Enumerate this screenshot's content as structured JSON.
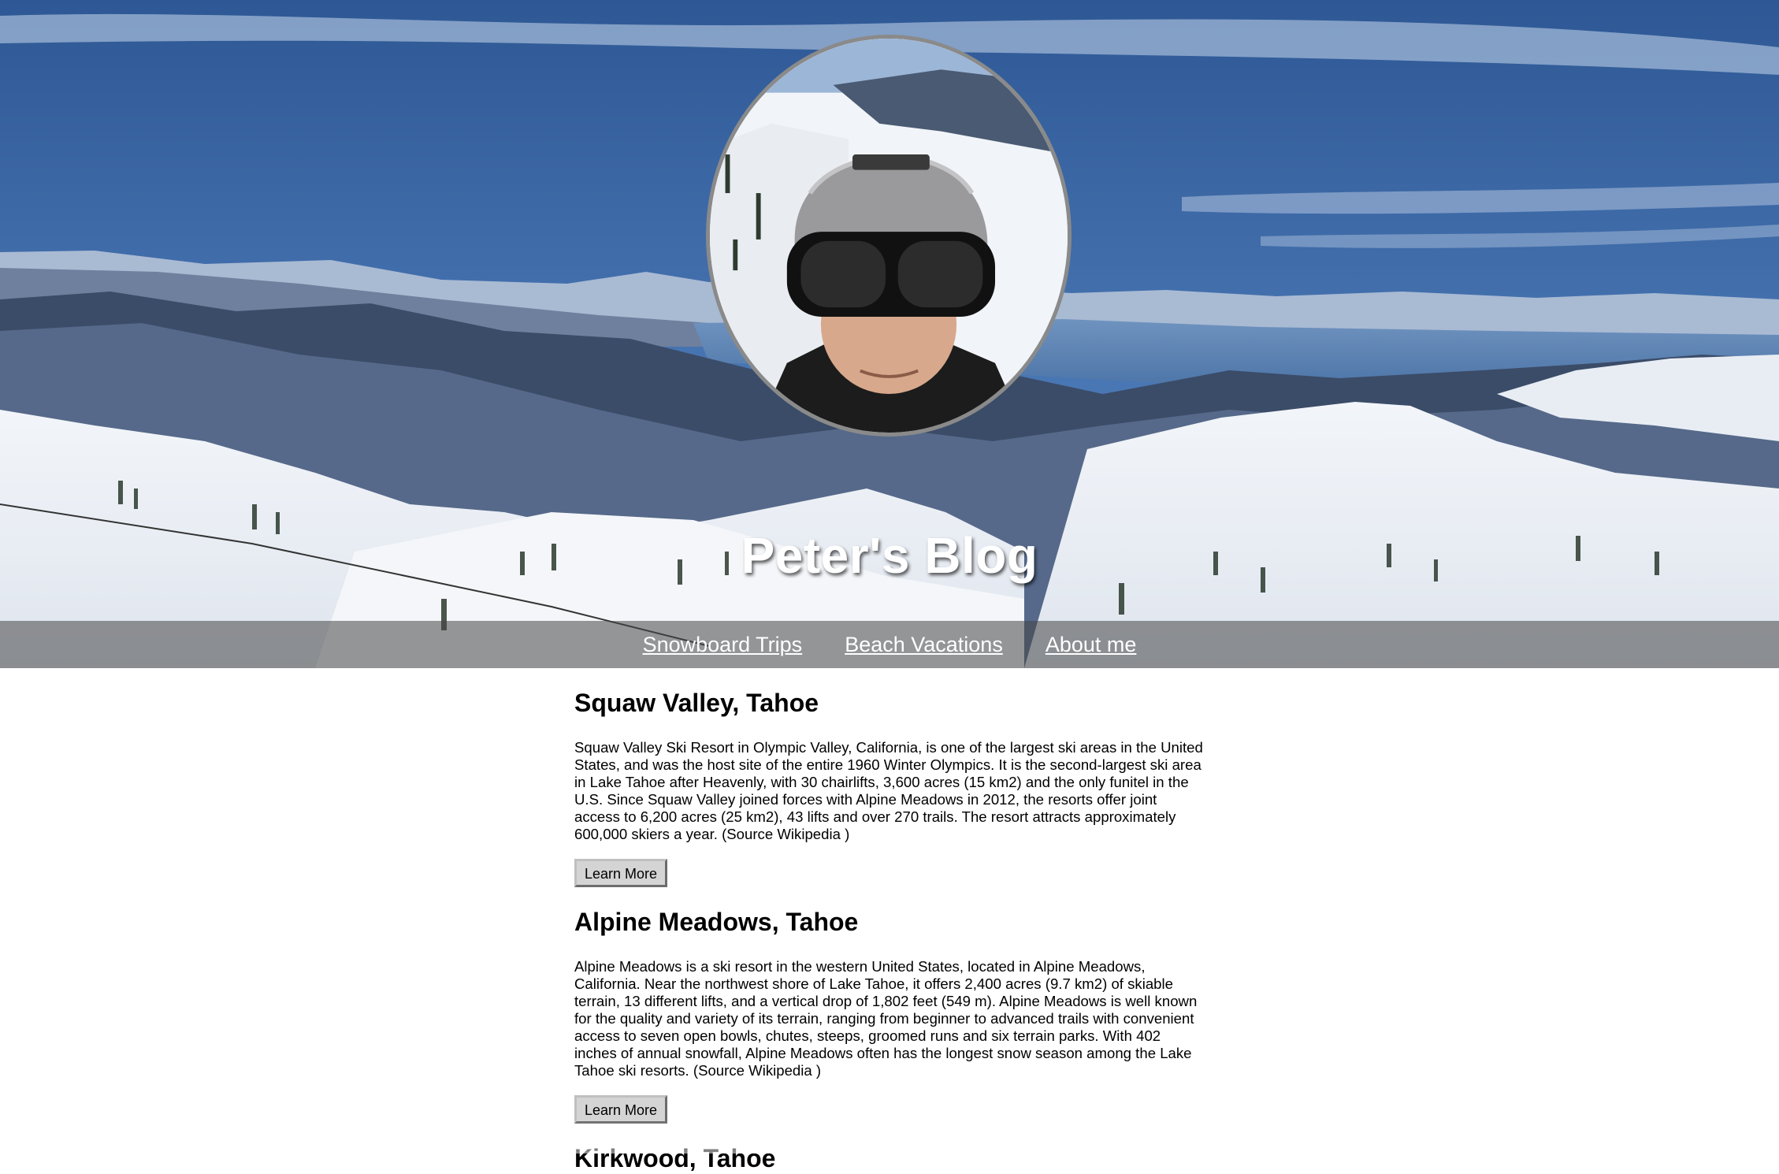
{
  "header": {
    "site_title": "Peter's Blog",
    "avatar_alt": "profile photo"
  },
  "nav": {
    "items": [
      {
        "label": "Snowboard Trips"
      },
      {
        "label": "Beach Vacations"
      },
      {
        "label": "About me"
      }
    ]
  },
  "posts": [
    {
      "title": "Squaw Valley, Tahoe",
      "body": "Squaw Valley Ski Resort in Olympic Valley, California, is one of the largest ski areas in the United States, and was the host site of the entire 1960 Winter Olympics. It is the second-largest ski area in Lake Tahoe after Heavenly, with 30 chairlifts, 3,600 acres (15 km2) and the only funitel in the U.S. Since Squaw Valley joined forces with Alpine Meadows in 2012, the resorts offer joint access to 6,200 acres (25 km2), 43 lifts and over 270 trails. The resort attracts approximately 600,000 skiers a year. (Source Wikipedia )",
      "button_label": "Learn More"
    },
    {
      "title": "Alpine Meadows, Tahoe",
      "body": "Alpine Meadows is a ski resort in the western United States, located in Alpine Meadows, California. Near the northwest shore of Lake Tahoe, it offers 2,400 acres (9.7 km2) of skiable terrain, 13 different lifts, and a vertical drop of 1,802 feet (549 m). Alpine Meadows is well known for the quality and variety of its terrain, ranging from beginner to advanced trails with convenient access to seven open bowls, chutes, steeps, groomed runs and six terrain parks. With 402 inches of annual snowfall, Alpine Meadows often has the longest snow season among the Lake Tahoe ski resorts. (Source Wikipedia )",
      "button_label": "Learn More"
    },
    {
      "title": "Kirkwood, Tahoe"
    }
  ],
  "colors": {
    "sky": "#3e68a6",
    "navbar_overlay": "rgba(70,70,70,0.55)",
    "button_bg": "#d4d4d4"
  }
}
